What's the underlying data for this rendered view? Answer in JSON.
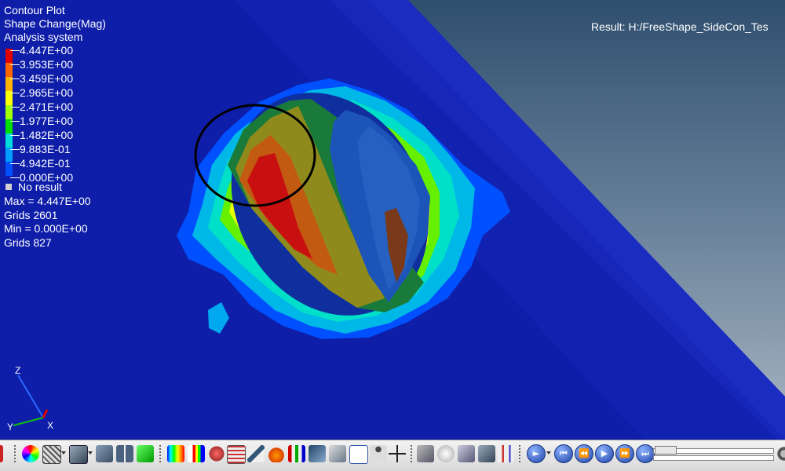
{
  "legend": {
    "title": "Contour Plot",
    "subtitle": "Shape Change(Mag)",
    "system": "Analysis system",
    "levels": [
      {
        "label": "4.447E+00",
        "color": "#e00000"
      },
      {
        "label": "3.953E+00",
        "color": "#ff6600"
      },
      {
        "label": "3.459E+00",
        "color": "#ffb400"
      },
      {
        "label": "2.965E+00",
        "color": "#ffff00"
      },
      {
        "label": "2.471E+00",
        "color": "#a0ff00"
      },
      {
        "label": "1.977E+00",
        "color": "#00e000"
      },
      {
        "label": "1.482E+00",
        "color": "#00dcdc"
      },
      {
        "label": "9.883E-01",
        "color": "#009cff"
      },
      {
        "label": "4.942E-01",
        "color": "#0050ff"
      },
      {
        "label": "0.000E+00",
        "color": "#0000c8"
      }
    ],
    "no_result": "No result",
    "max": "Max = 4.447E+00",
    "max_grid": "Grids 2601",
    "min": "Min = 0.000E+00",
    "min_grid": "Grids 827"
  },
  "result_path": "Result: H:/FreeShape_SideCon_Tes",
  "axes": {
    "z": "Z",
    "y": "Y",
    "x": "X"
  },
  "toolbar": {
    "icons": [
      "color-wheel-icon",
      "mesh-cube-icon",
      "solid-cube-icon",
      "multi-view-icon",
      "mirror-icon",
      "green-blocks-icon",
      "contour-bar-icon",
      "legend-bar-icon",
      "deform-icon",
      "wire-cube-icon",
      "pen-icon",
      "hand-icon",
      "vector-icon",
      "streamline-icon",
      "cut-plane-icon",
      "note-icon",
      "person-icon",
      "measure-icon",
      "probe-icon",
      "comment-icon",
      "ruler-icon",
      "query-icon",
      "plot-icon"
    ],
    "nav": [
      "first-frame-icon",
      "previous-frame-icon",
      "play-icon",
      "next-frame-icon",
      "last-frame-icon"
    ]
  }
}
